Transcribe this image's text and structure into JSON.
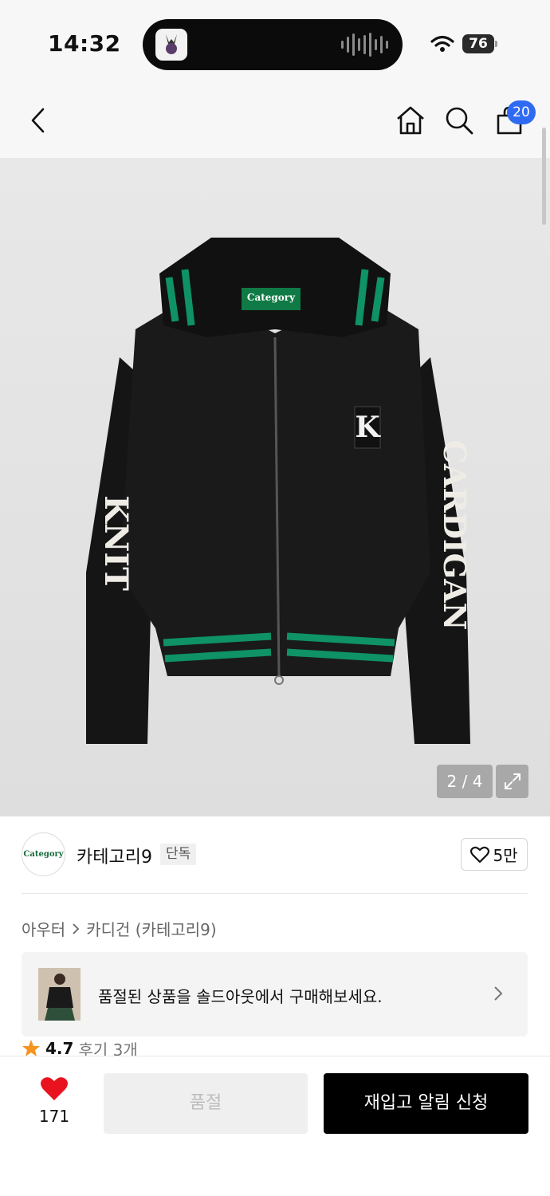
{
  "status_bar": {
    "time": "14:32",
    "battery": "76"
  },
  "nav": {
    "back_icon": "chevron-left-icon",
    "home_icon": "home-icon",
    "search_icon": "search-icon",
    "cart_icon": "shopping-bag-icon",
    "cart_count": "20"
  },
  "image": {
    "counter": "2 / 4",
    "expand_icon": "expand-icon",
    "tag_text": "Category",
    "chest_letter": "K",
    "left_sleeve_text": "KNIT",
    "right_sleeve_text": "CARDIGAN"
  },
  "brand": {
    "logo_text": "Category",
    "name": "카테고리9",
    "badge": "단독",
    "likes": "5만"
  },
  "breadcrumb": {
    "category": "아우터",
    "subcategory": "카디건 (카테고리9)"
  },
  "banner": {
    "text": "품절된 상품을 솔드아웃에서 구매해보세요."
  },
  "rating": {
    "score": "4.7",
    "reviews": "후기 3개"
  },
  "bottom": {
    "wish_count": "171",
    "soldout_label": "품절",
    "restock_label": "재입고 알림 신청"
  },
  "colors": {
    "accent_blue": "#2f6bf2",
    "heart_red": "#e8131f",
    "star_orange": "#f5941f",
    "stripe_green": "#0e9266"
  }
}
